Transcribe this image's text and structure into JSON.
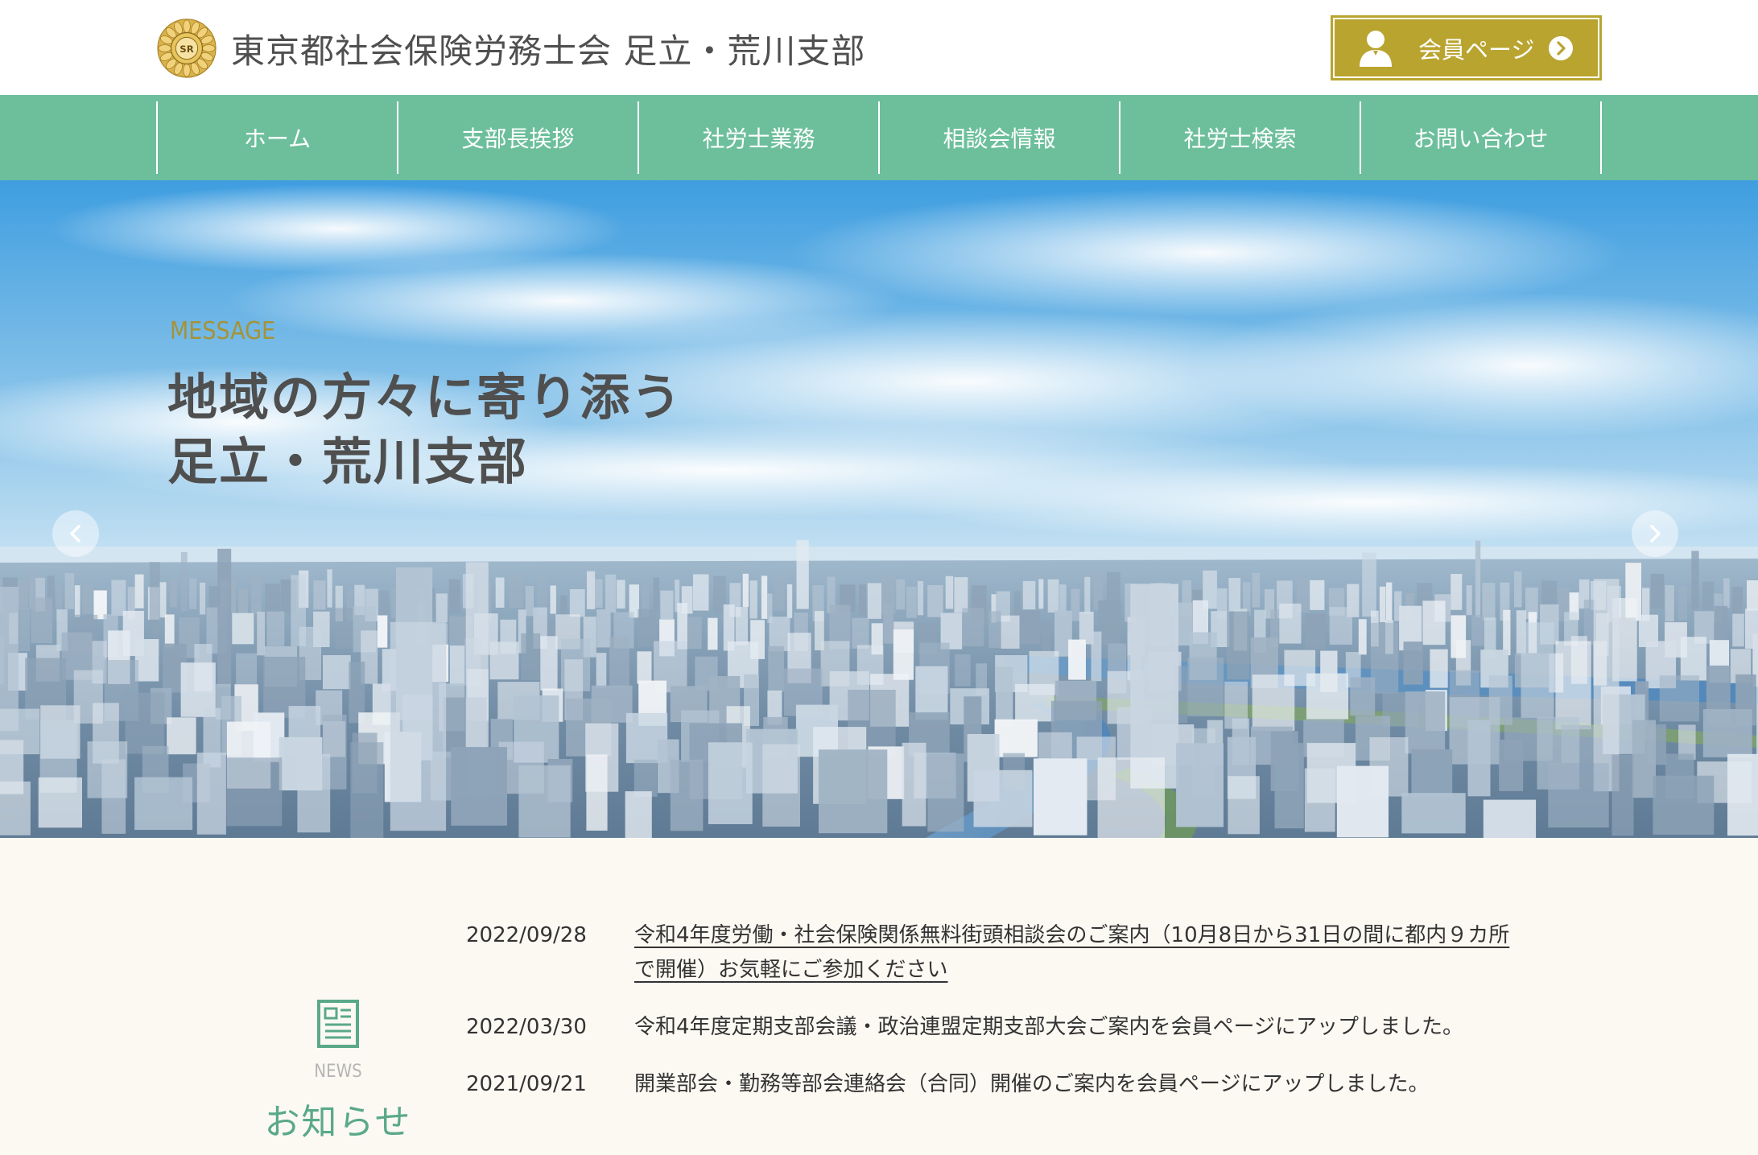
{
  "header": {
    "site_title": "東京都社会保険労務士会 足立・荒川支部",
    "logo_icon": "sr-emblem-icon",
    "member_button": {
      "label": "会員ページ",
      "icon": "person-icon",
      "arrow_icon": "circle-arrow-right-icon"
    }
  },
  "nav": {
    "items": [
      {
        "label": "ホーム"
      },
      {
        "label": "支部長挨拶"
      },
      {
        "label": "社労士業務"
      },
      {
        "label": "相談会情報"
      },
      {
        "label": "社労士検索"
      },
      {
        "label": "お問い合わせ"
      }
    ]
  },
  "hero": {
    "kicker": "MESSAGE",
    "headline_line1": "地域の方々に寄り添う",
    "headline_line2": "足立・荒川支部",
    "prev_icon": "chevron-left-icon",
    "next_icon": "chevron-right-icon"
  },
  "news": {
    "icon": "newspaper-icon",
    "heading_en": "NEWS",
    "heading_ja": "お知らせ",
    "items": [
      {
        "date": "2022/09/28",
        "text": "令和4年度労働・社会保険関係無料街頭相談会のご案内（10月8日から31日の間に都内９カ所で開催）お気軽にご参加ください",
        "link": true
      },
      {
        "date": "2022/03/30",
        "text": "令和4年度定期支部会議・政治連盟定期支部大会ご案内を会員ページにアップしました。",
        "link": false
      },
      {
        "date": "2021/09/21",
        "text": "開業部会・勤務等部会連絡会（合同）開催のご案内を会員ページにアップしました。",
        "link": false
      }
    ]
  },
  "colors": {
    "nav_green": "#6dbf9c",
    "gold": "#b9a430",
    "news_green": "#5aa988",
    "news_bg": "#fcf9f3"
  }
}
